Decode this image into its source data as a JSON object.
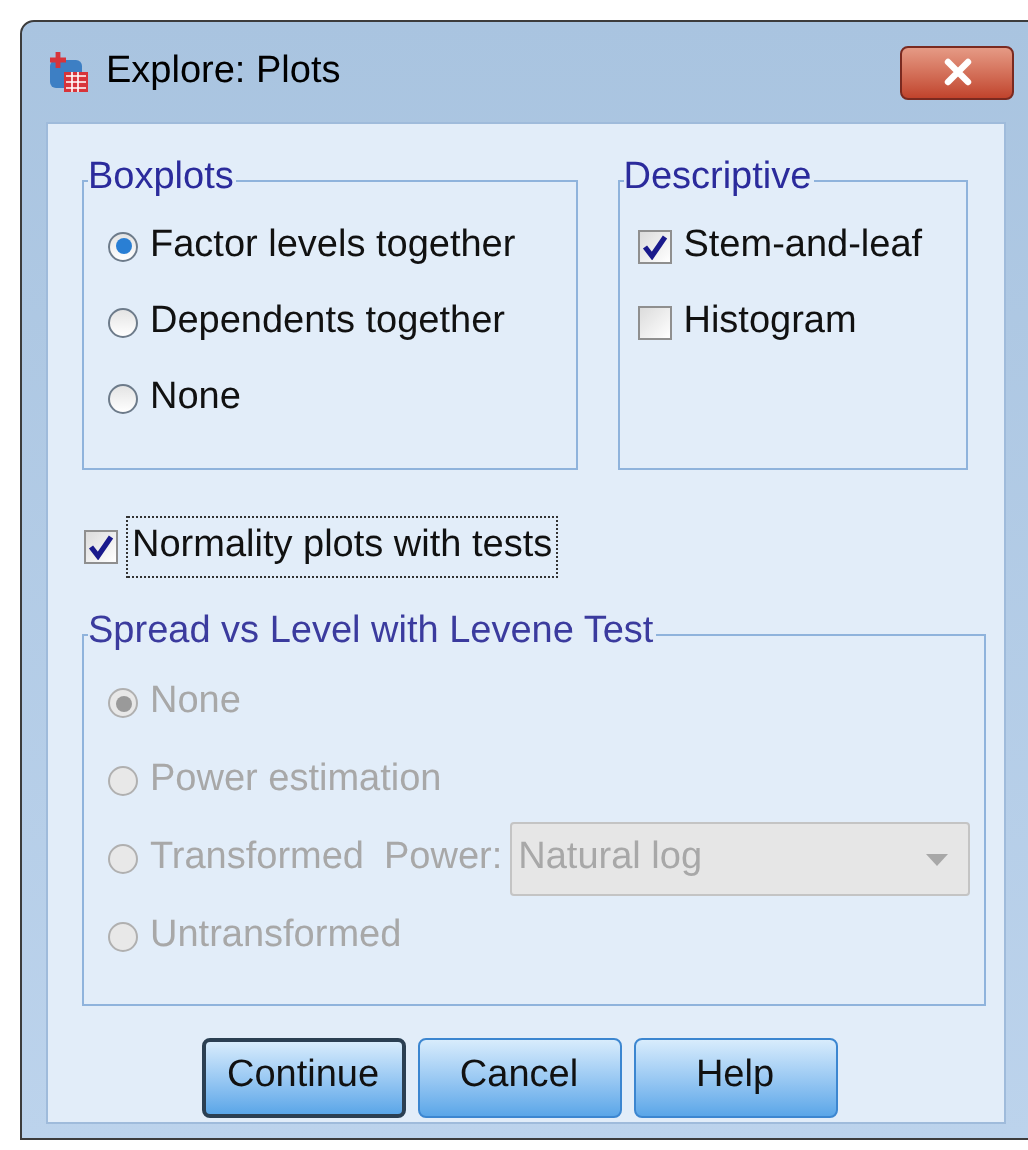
{
  "window": {
    "title": "Explore: Plots"
  },
  "boxplots": {
    "title": "Boxplots",
    "options": [
      {
        "label": "Factor levels together",
        "selected": true
      },
      {
        "label": "Dependents together",
        "selected": false
      },
      {
        "label": "None",
        "selected": false
      }
    ]
  },
  "descriptive": {
    "title": "Descriptive",
    "options": [
      {
        "label": "Stem-and-leaf",
        "checked": true
      },
      {
        "label": "Histogram",
        "checked": false
      }
    ]
  },
  "normality": {
    "label": "Normality plots with tests",
    "checked": true,
    "focused": true
  },
  "spread": {
    "title": "Spread vs Level with Levene Test",
    "disabled": true,
    "options": [
      {
        "label": "None",
        "selected": true
      },
      {
        "label": "Power estimation",
        "selected": false
      },
      {
        "label": "Transformed",
        "selected": false
      },
      {
        "label": "Untransformed",
        "selected": false
      }
    ],
    "power": {
      "label": "Power:",
      "value": "Natural log"
    }
  },
  "buttons": [
    {
      "label": "Continue",
      "default": true
    },
    {
      "label": "Cancel",
      "default": false
    },
    {
      "label": "Help",
      "default": false
    }
  ]
}
